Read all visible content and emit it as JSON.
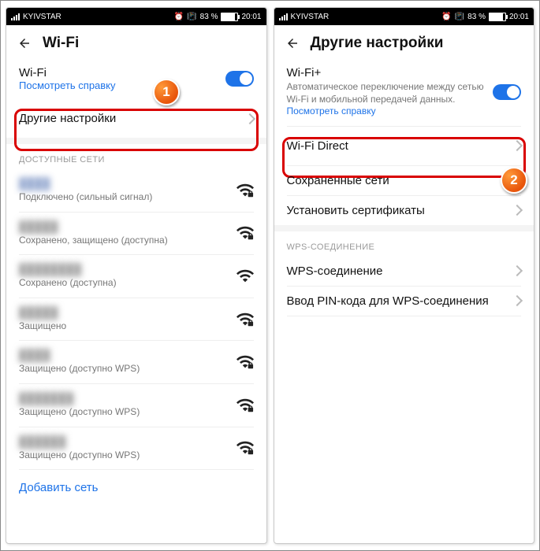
{
  "status": {
    "carrier": "KYIVSTAR",
    "battery_pct": "83 %",
    "time": "20:01",
    "alarm_glyph": "⏰",
    "vib_glyph": "📳"
  },
  "left": {
    "header_title": "Wi-Fi",
    "wifi_label": "Wi-Fi",
    "help_link": "Посмотреть справку",
    "other_settings": "Другие настройки",
    "section_networks": "ДОСТУПНЫЕ СЕТИ",
    "net1_status": "Подключено (сильный сигнал)",
    "net2_status": "Сохранено, защищено (доступна)",
    "net3_status": "Сохранено (доступна)",
    "net4_status": "Защищено",
    "net5_status": "Защищено (доступно WPS)",
    "net6_status": "Защищено (доступно WPS)",
    "net7_status": "Защищено (доступно WPS)",
    "add_network": "Добавить сеть",
    "badge": "1"
  },
  "right": {
    "header_title": "Другие настройки",
    "wifiplus_title": "Wi-Fi+",
    "wifiplus_desc": "Автоматическое переключение между сетью Wi-Fi и мобильной передачей данных.",
    "wifiplus_help": "Посмотреть справку",
    "wifi_direct": "Wi-Fi Direct",
    "saved_networks": "Сохраненные сети",
    "install_certs": "Установить сертификаты",
    "section_wps": "WPS-СОЕДИНЕНИЕ",
    "wps_conn": "WPS-соединение",
    "wps_pin": "Ввод PIN-кода для WPS-соединения",
    "badge": "2"
  }
}
